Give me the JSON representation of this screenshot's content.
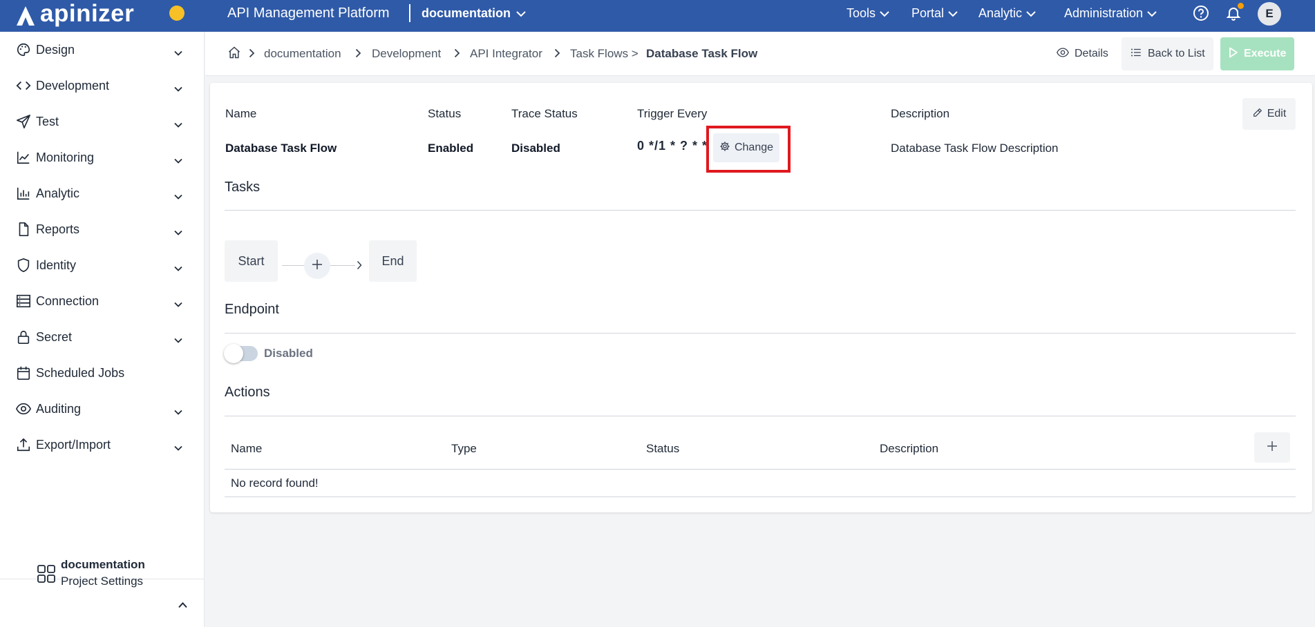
{
  "topbar": {
    "brand": "apinizer",
    "platform_title": "API Management Platform",
    "project": "documentation",
    "menus": [
      {
        "label": "Tools"
      },
      {
        "label": "Portal"
      },
      {
        "label": "Analytic"
      },
      {
        "label": "Administration"
      }
    ],
    "user_initial": "E",
    "colors": {
      "bar": "#2f5aa8",
      "brand_dot": "#f6c026",
      "notification_dot": "#f59e0b"
    }
  },
  "sidebar": {
    "items": [
      {
        "label": "Design",
        "icon": "palette-icon",
        "expandable": true
      },
      {
        "label": "Development",
        "icon": "code-icon",
        "expandable": true
      },
      {
        "label": "Test",
        "icon": "send-icon",
        "expandable": true
      },
      {
        "label": "Monitoring",
        "icon": "line-chart-icon",
        "expandable": true
      },
      {
        "label": "Analytic",
        "icon": "bar-chart-icon",
        "expandable": true
      },
      {
        "label": "Reports",
        "icon": "file-icon",
        "expandable": true
      },
      {
        "label": "Identity",
        "icon": "shield-icon",
        "expandable": true
      },
      {
        "label": "Connection",
        "icon": "server-icon",
        "expandable": true
      },
      {
        "label": "Secret",
        "icon": "lock-icon",
        "expandable": true
      },
      {
        "label": "Scheduled Jobs",
        "icon": "calendar-icon",
        "expandable": false
      },
      {
        "label": "Auditing",
        "icon": "eye-icon",
        "expandable": true
      },
      {
        "label": "Export/Import",
        "icon": "upload-icon",
        "expandable": true
      }
    ],
    "footer": {
      "name": "documentation",
      "sub": "Project Settings"
    }
  },
  "breadcrumb": {
    "items": [
      "documentation",
      "Development",
      "API Integrator",
      "Task Flows >"
    ],
    "current": "Database Task Flow"
  },
  "header_actions": {
    "details": "Details",
    "back": "Back to List",
    "execute": "Execute"
  },
  "taskflow": {
    "labels": {
      "name": "Name",
      "status": "Status",
      "trace": "Trace Status",
      "trigger": "Trigger Every",
      "description": "Description"
    },
    "values": {
      "name": "Database Task Flow",
      "status": "Enabled",
      "trace": "Disabled",
      "trigger": "0 */1 * ? * *",
      "description": "Database Task Flow Description"
    },
    "change_label": "Change",
    "edit_label": "Edit"
  },
  "tasks": {
    "title": "Tasks",
    "start": "Start",
    "end": "End"
  },
  "endpoint": {
    "title": "Endpoint",
    "toggle_label": "Disabled",
    "enabled": false
  },
  "actions": {
    "title": "Actions",
    "columns": [
      "Name",
      "Type",
      "Status",
      "Description"
    ],
    "empty": "No record found!"
  }
}
